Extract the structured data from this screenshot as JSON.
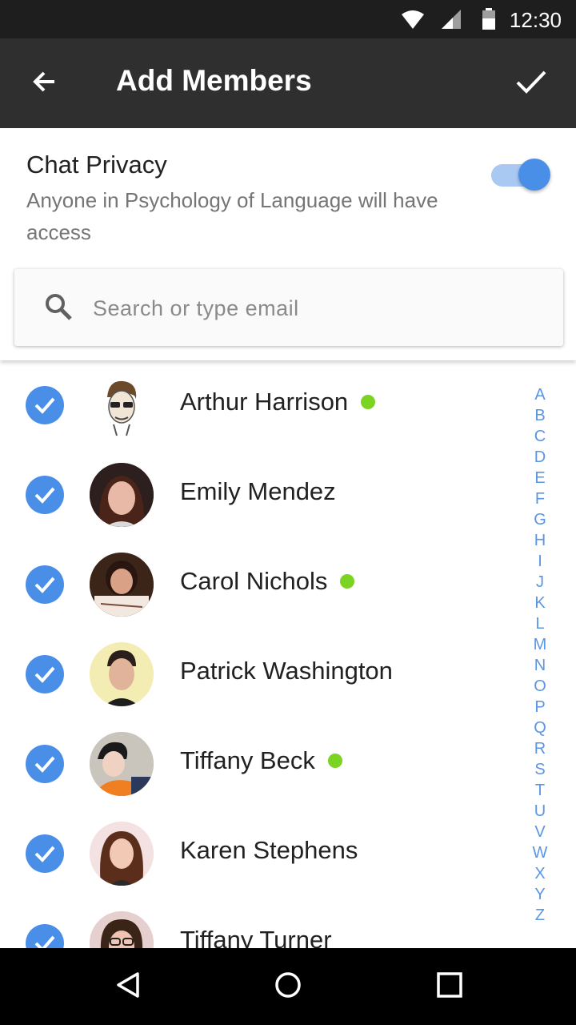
{
  "status_bar": {
    "time": "12:30",
    "icons": [
      "wifi-icon",
      "signal-icon",
      "battery-icon"
    ]
  },
  "app_bar": {
    "title": "Add Members",
    "back_icon": "arrow-left-icon",
    "confirm_icon": "check-icon"
  },
  "privacy": {
    "label": "Chat Privacy",
    "description": "Anyone in Psychology of Language will have access",
    "toggle_on": true
  },
  "search": {
    "placeholder": "Search or type email",
    "value": ""
  },
  "members": [
    {
      "name": "Arthur Harrison",
      "online": true,
      "checked": true
    },
    {
      "name": "Emily Mendez",
      "online": false,
      "checked": true
    },
    {
      "name": "Carol Nichols",
      "online": true,
      "checked": true
    },
    {
      "name": "Patrick Washington",
      "online": false,
      "checked": true
    },
    {
      "name": "Tiffany Beck",
      "online": true,
      "checked": true
    },
    {
      "name": "Karen Stephens",
      "online": false,
      "checked": true
    },
    {
      "name": "Tiffany Turner",
      "online": false,
      "checked": true
    }
  ],
  "alpha_index": [
    "A",
    "B",
    "C",
    "D",
    "E",
    "F",
    "G",
    "H",
    "I",
    "J",
    "K",
    "L",
    "M",
    "N",
    "O",
    "P",
    "Q",
    "R",
    "S",
    "T",
    "U",
    "V",
    "W",
    "X",
    "Y",
    "Z"
  ],
  "colors": {
    "accent": "#4a8fe7",
    "online": "#7bd324",
    "app_bar": "#2f2f2f",
    "status_bar": "#1e1e1e"
  },
  "nav_bar": {
    "buttons": [
      "back-triangle-icon",
      "home-circle-icon",
      "recents-square-icon"
    ]
  }
}
